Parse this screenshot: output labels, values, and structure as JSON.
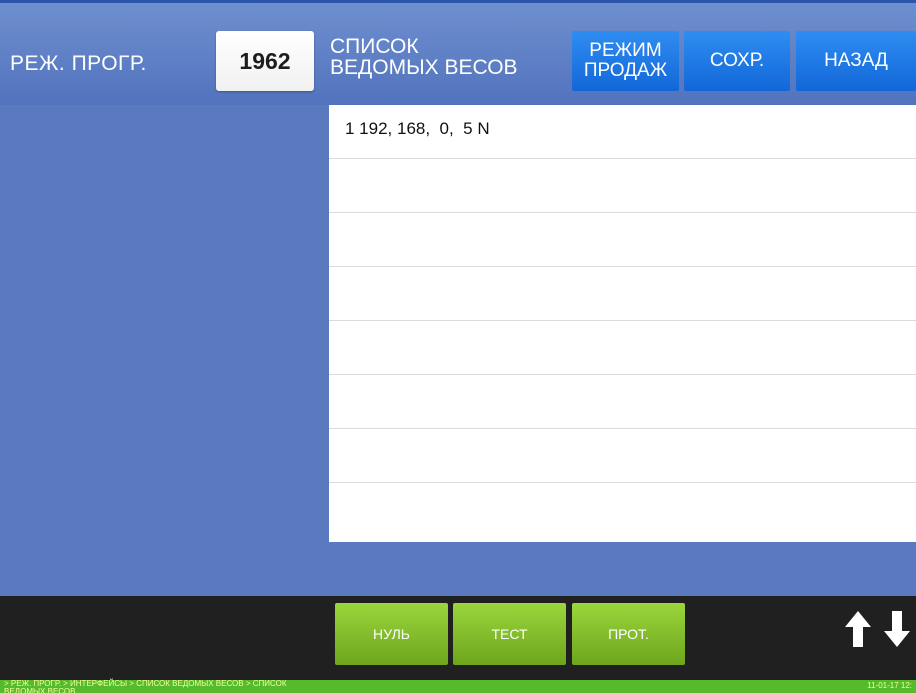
{
  "header": {
    "mode_label": "РЕЖ. ПРОГР.",
    "code": "1962",
    "title": "СПИСОК\nВЕДОМЫХ ВЕСОВ",
    "buttons": {
      "sales_mode": "РЕЖИМ\nПРОДАЖ",
      "save": "СОХР.",
      "back": "НАЗАД"
    }
  },
  "list": {
    "rows": [
      "1 192, 168,  0,  5 N",
      "",
      "",
      "",
      "",
      "",
      "",
      ""
    ]
  },
  "toolbar": {
    "zero": "НУЛЬ",
    "test": "ТЕСТ",
    "prot": "ПРОТ.",
    "up_icon": "arrow-up-icon",
    "down_icon": "arrow-down-icon"
  },
  "status": {
    "breadcrumb": "> РЕЖ. ПРОГР.  > ИНТЕРФЕЙСЫ > СПИСОК ВЕДОМЫХ ВЕСОВ > СПИСОК\nВЕДОМЫХ ВЕСОВ",
    "clock": "11-01-17 12:"
  },
  "colors": {
    "header": "#5b79bf",
    "button_blue": "#1f7ae6",
    "button_green": "#84c12b",
    "toolbar": "#202020",
    "status_bar": "#55bb2c"
  }
}
